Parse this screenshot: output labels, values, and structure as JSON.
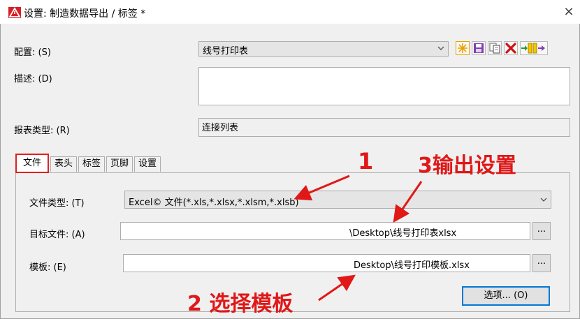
{
  "window": {
    "title": "设置: 制造数据导出 / 标签 *",
    "close_label": "×"
  },
  "fields": {
    "config_label": "配置: (S)",
    "config_value": "线号打印表",
    "description_label": "描述: (D)",
    "description_value": "",
    "report_type_label": "报表类型: (R)",
    "report_type_value": "连接列表"
  },
  "toolbar": {
    "icons": [
      "new-icon",
      "save-icon",
      "copy-icon",
      "delete-icon",
      "import-export-icon"
    ],
    "delete_glyph": "✖"
  },
  "tabs": [
    {
      "label": "文件",
      "active": true
    },
    {
      "label": "表头",
      "active": false
    },
    {
      "label": "标签",
      "active": false
    },
    {
      "label": "页脚",
      "active": false
    },
    {
      "label": "设置",
      "active": false
    }
  ],
  "file_tab": {
    "file_type_label": "文件类型: (T)",
    "file_type_value": "Excel© 文件(*.xls,*.xlsx,*.xlsm,*.xlsb)",
    "target_file_label": "目标文件: (A)",
    "target_file_value": "\\Desktop\\线号打印表xlsx",
    "template_label": "模板: (E)",
    "template_value": "Desktop\\线号打印模板.xlsx",
    "browse_label": "...",
    "options_button": "选项... (O)"
  },
  "annotations": {
    "one": "1",
    "two": "2 选择模板",
    "three": "3输出设置",
    "color": "#e01818"
  }
}
